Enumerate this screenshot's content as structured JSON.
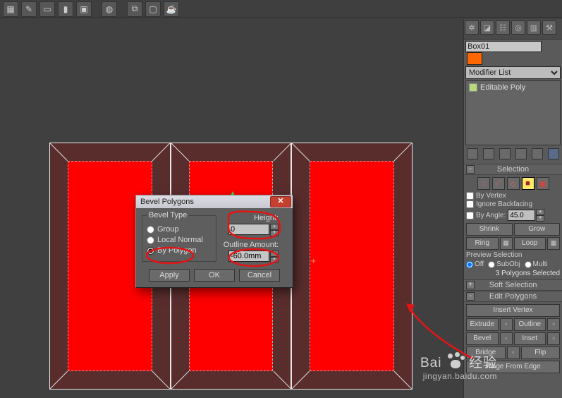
{
  "toolbar_icons": [
    "layout",
    "open",
    "window",
    "materials",
    "render",
    "globe",
    "copy",
    "paste",
    "teapot"
  ],
  "cmd_tabs": [
    "create",
    "modify",
    "hierarchy",
    "motion",
    "display",
    "utilities"
  ],
  "object_name": "Box01",
  "object_color": "#ff6600",
  "modifier_list_label": "Modifier List",
  "stack_item": "Editable Poly",
  "rollouts": {
    "selection": {
      "title": "Selection",
      "sub_icons": [
        "vertex",
        "edge",
        "border",
        "polygon",
        "element"
      ],
      "active_sub": "polygon",
      "by_vertex": "By Vertex",
      "ignore_backfacing": "Ignore Backfacing",
      "by_angle": "By Angle:",
      "angle_value": "45.0",
      "shrink": "Shrink",
      "grow": "Grow",
      "ring": "Ring",
      "loop": "Loop",
      "preview_label": "Preview Selection",
      "preview_off": "Off",
      "preview_subobj": "SubObj",
      "preview_multi": "Multi",
      "selected_text": "3 Polygons Selected"
    },
    "soft_selection": {
      "title": "Soft Selection"
    },
    "edit_polygons": {
      "title": "Edit Polygons",
      "insert_vertex": "Insert Vertex",
      "extrude": "Extrude",
      "outline": "Outline",
      "bevel": "Bevel",
      "inset": "Inset",
      "bridge": "Bridge",
      "flip": "Flip",
      "hinge": "Hinge From Edge"
    }
  },
  "dialog": {
    "title": "Bevel Polygons",
    "group_legend": "Bevel Type",
    "opt_group": "Group",
    "opt_local": "Local Normal",
    "opt_poly": "By Polygon",
    "height_label": "Height:",
    "height_value": "0",
    "outline_label": "Outline Amount:",
    "outline_value": "-60.0mm",
    "apply": "Apply",
    "ok": "OK",
    "cancel": "Cancel"
  },
  "watermark": {
    "brand_pre": "Bai",
    "brand_post": "经验",
    "url": "jingyan.baidu.com"
  }
}
